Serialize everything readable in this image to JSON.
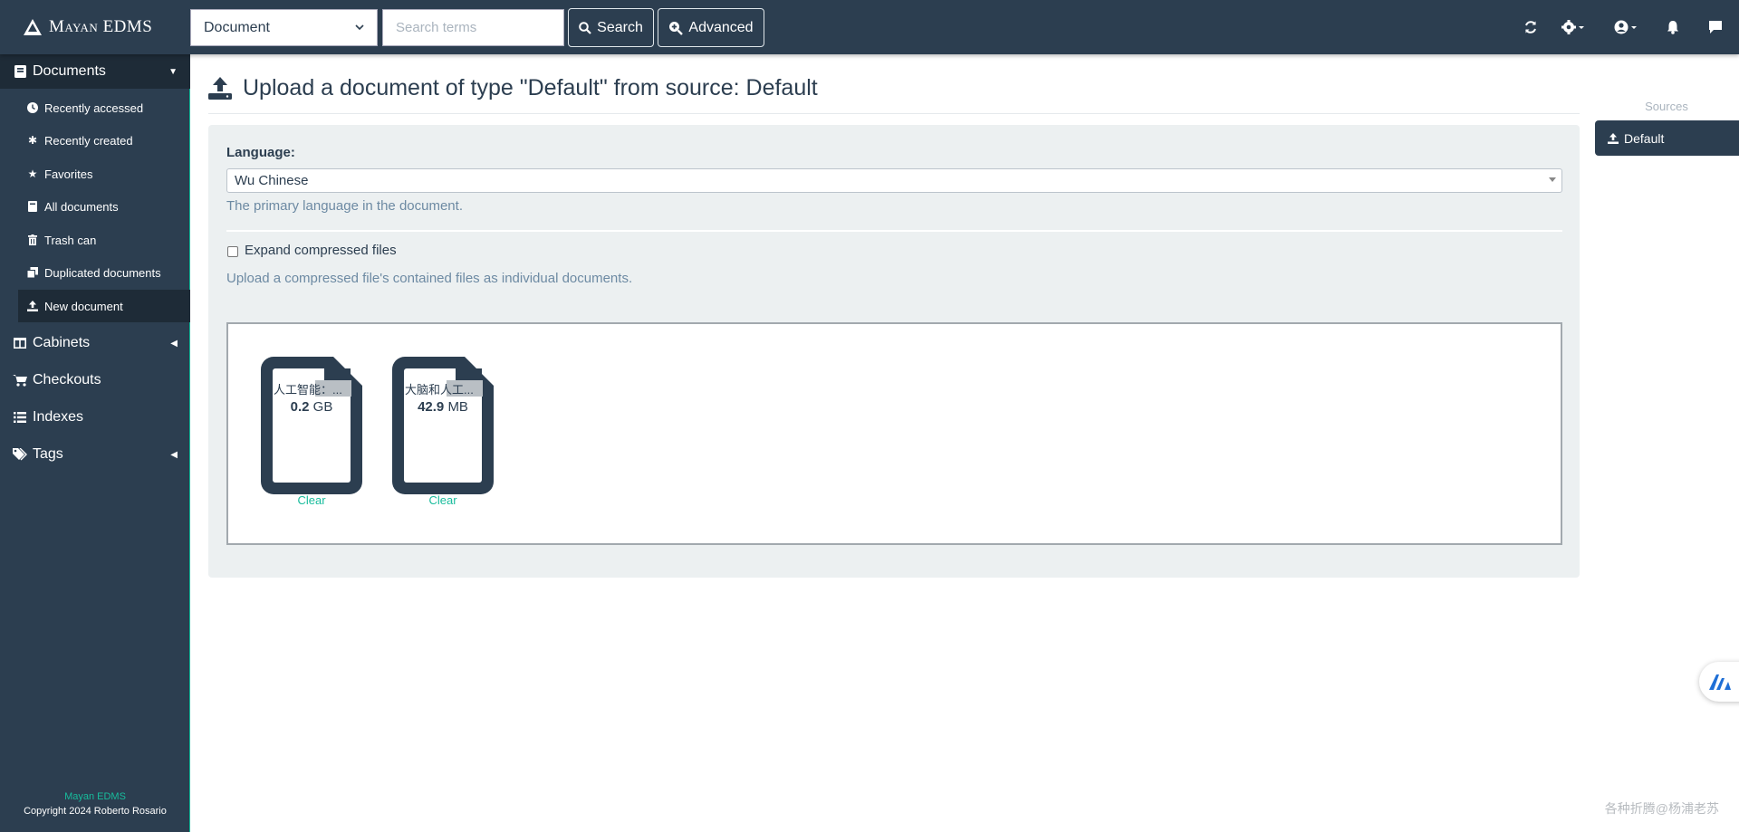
{
  "app": {
    "brand_name": "Mayan EDMS",
    "accent_color": "#18bc9c",
    "nav_color": "#2c3e50"
  },
  "search": {
    "scope_selected": "Document",
    "placeholder": "Search terms",
    "search_label": "Search",
    "advanced_label": "Advanced"
  },
  "topbar_icons": [
    "refresh-icon",
    "settings-gear-icon",
    "user-icon",
    "bell-icon",
    "comment-icon"
  ],
  "sidebar": {
    "menus": [
      {
        "label": "Documents",
        "icon": "book-icon",
        "expanded": true
      },
      {
        "label": "Cabinets",
        "icon": "columns-icon"
      },
      {
        "label": "Checkouts",
        "icon": "cart-icon"
      },
      {
        "label": "Indexes",
        "icon": "list-icon"
      },
      {
        "label": "Tags",
        "icon": "tags-icon"
      }
    ],
    "documents_items": [
      {
        "label": "Recently accessed",
        "icon": "clock-icon"
      },
      {
        "label": "Recently created",
        "icon": "asterisk-icon"
      },
      {
        "label": "Favorites",
        "icon": "star-icon"
      },
      {
        "label": "All documents",
        "icon": "book-icon"
      },
      {
        "label": "Trash can",
        "icon": "trash-icon"
      },
      {
        "label": "Duplicated documents",
        "icon": "copy-icon"
      },
      {
        "label": "New document",
        "icon": "upload-icon",
        "active": true
      }
    ],
    "footer_app": "Mayan EDMS",
    "footer_copyright": "Copyright 2024 Roberto Rosario"
  },
  "page": {
    "title": "Upload a document of type \"Default\" from source: Default",
    "language_label": "Language:",
    "language_value": "Wu Chinese",
    "language_help": "The primary language in the document.",
    "expand_label": "Expand compressed files",
    "expand_checked": false,
    "expand_help": "Upload a compressed file's contained files as individual documents."
  },
  "files": [
    {
      "name": "人工智能：...",
      "size_value": "0.2",
      "size_unit": "GB",
      "clear_label": "Clear"
    },
    {
      "name": "大脑和人工...",
      "size_value": "42.9",
      "size_unit": "MB",
      "clear_label": "Clear"
    }
  ],
  "sources": {
    "heading": "Sources",
    "items": [
      {
        "label": "Default",
        "active": true
      }
    ]
  },
  "watermark": "各种折腾@杨浦老苏"
}
